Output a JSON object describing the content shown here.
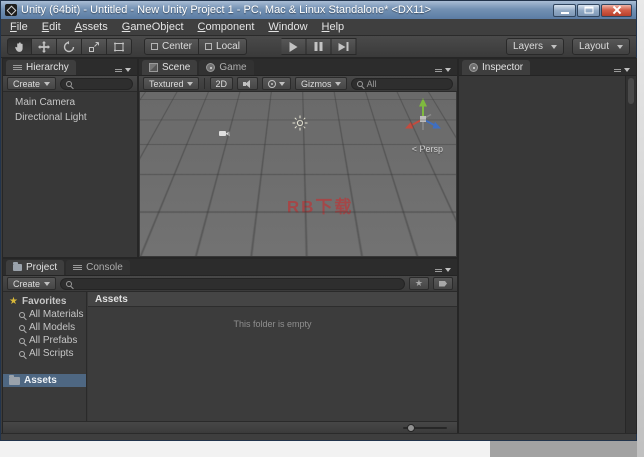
{
  "window": {
    "title": "Unity (64bit) - Untitled - New Unity Project 1 - PC, Mac & Linux Standalone* <DX11>"
  },
  "menu": {
    "items": [
      "File",
      "Edit",
      "Assets",
      "GameObject",
      "Component",
      "Window",
      "Help"
    ]
  },
  "toolbar": {
    "pivot": "Center",
    "space": "Local",
    "layers": "Layers",
    "layout": "Layout"
  },
  "hierarchy": {
    "tab": "Hierarchy",
    "create": "Create",
    "items": [
      "Main Camera",
      "Directional Light"
    ]
  },
  "scene": {
    "tab": "Scene",
    "game_tab": "Game",
    "render_mode": "Textured",
    "mode_2d": "2D",
    "gizmos": "Gizmos",
    "search_text": "All",
    "persp": "< Persp",
    "watermark": "RB下载"
  },
  "inspector": {
    "tab": "Inspector"
  },
  "project": {
    "tab": "Project",
    "console_tab": "Console",
    "create": "Create",
    "favorites_title": "Favorites",
    "favorites": [
      "All Materials",
      "All Models",
      "All Prefabs",
      "All Scripts"
    ],
    "assets_folder": "Assets",
    "header": "Assets",
    "empty": "This folder is empty"
  },
  "icons": {
    "star": "★"
  }
}
